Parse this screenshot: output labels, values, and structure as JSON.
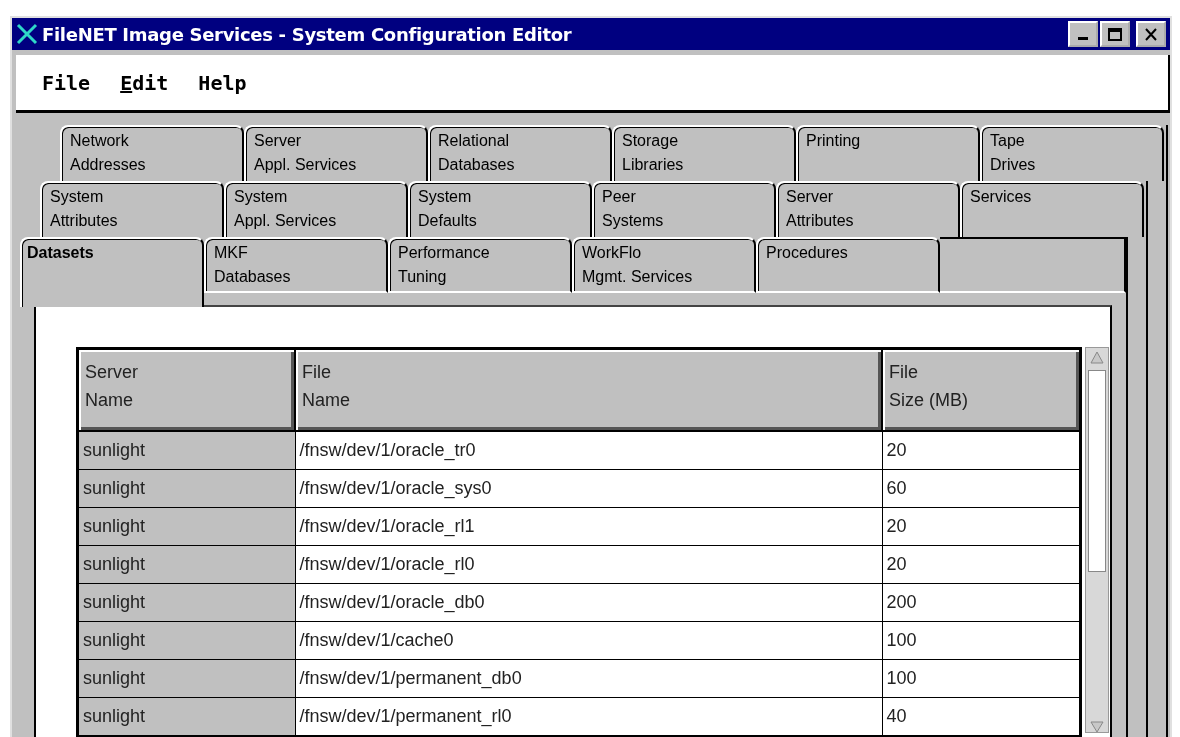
{
  "window": {
    "title": "FileNET Image Services - System Configuration Editor"
  },
  "menu": [
    {
      "label": "File",
      "mnemonic": false
    },
    {
      "label": "Edit",
      "mnemonic": true
    },
    {
      "label": "Help",
      "mnemonic": false
    }
  ],
  "tab_rows": [
    [
      {
        "label": "Network\nAddresses",
        "selected": false
      },
      {
        "label": "Server\nAppl. Services",
        "selected": false
      },
      {
        "label": "Relational\nDatabases",
        "selected": false
      },
      {
        "label": "Storage\nLibraries",
        "selected": false
      },
      {
        "label": "Printing",
        "selected": false
      },
      {
        "label": "Tape\nDrives",
        "selected": false
      }
    ],
    [
      {
        "label": "System\nAttributes",
        "selected": false
      },
      {
        "label": "System\nAppl. Services",
        "selected": false
      },
      {
        "label": "System\nDefaults",
        "selected": false
      },
      {
        "label": "Peer\nSystems",
        "selected": false
      },
      {
        "label": "Server\nAttributes",
        "selected": false
      },
      {
        "label": "Services",
        "selected": false
      }
    ],
    [
      {
        "label": "Datasets",
        "selected": true
      },
      {
        "label": "MKF\nDatabases",
        "selected": false
      },
      {
        "label": "Performance\nTuning",
        "selected": false
      },
      {
        "label": "WorkFlo\nMgmt. Services",
        "selected": false
      },
      {
        "label": "Procedures",
        "selected": false
      }
    ]
  ],
  "table": {
    "columns": [
      "Server\nName",
      "File\nName",
      "File\nSize (MB)"
    ],
    "rows": [
      [
        "sunlight",
        "/fnsw/dev/1/oracle_tr0",
        "20"
      ],
      [
        "sunlight",
        "/fnsw/dev/1/oracle_sys0",
        "60"
      ],
      [
        "sunlight",
        "/fnsw/dev/1/oracle_rl1",
        "20"
      ],
      [
        "sunlight",
        "/fnsw/dev/1/oracle_rl0",
        "20"
      ],
      [
        "sunlight",
        "/fnsw/dev/1/oracle_db0",
        "200"
      ],
      [
        "sunlight",
        "/fnsw/dev/1/cache0",
        "100"
      ],
      [
        "sunlight",
        "/fnsw/dev/1/permanent_db0",
        "100"
      ],
      [
        "sunlight",
        "/fnsw/dev/1/permanent_rl0",
        "40"
      ]
    ]
  }
}
